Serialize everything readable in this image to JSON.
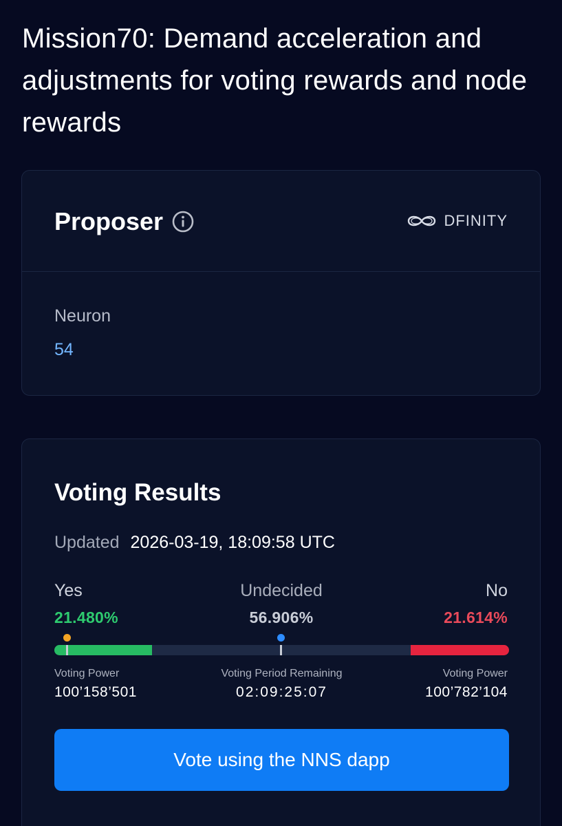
{
  "page": {
    "title": "Mission70: Demand acceleration and adjustments for voting rewards and node rewards"
  },
  "proposer": {
    "heading": "Proposer",
    "org_name": "DFINITY",
    "neuron_label": "Neuron",
    "neuron_id": "54"
  },
  "voting": {
    "heading": "Voting Results",
    "updated_label": "Updated",
    "updated_value": "2026-03-19, 18:09:58 UTC",
    "yes": {
      "label": "Yes",
      "percent": "21.480%",
      "fraction": 0.2148,
      "power_label": "Voting Power",
      "power": "100’158’501"
    },
    "undecided": {
      "label": "Undecided",
      "percent": "56.906%",
      "fraction": 0.56906
    },
    "no": {
      "label": "No",
      "percent": "21.614%",
      "fraction": 0.21614,
      "power_label": "Voting Power",
      "power": "100’782’104"
    },
    "remaining_label": "Voting Period Remaining",
    "remaining_value": "02:09:25:07",
    "vote_button": "Vote using the NNS dapp"
  },
  "colors": {
    "background": "#060a21",
    "card": "#0b1229",
    "yes": "#27bb63",
    "no": "#e6243f",
    "accent": "#0f7cf5",
    "link": "#73b6ff"
  },
  "icons": {
    "info": "info-circle-icon",
    "brand": "infinity-logo-icon",
    "yes_marker": "orange-dot-icon",
    "undecided_marker": "blue-dot-icon"
  }
}
